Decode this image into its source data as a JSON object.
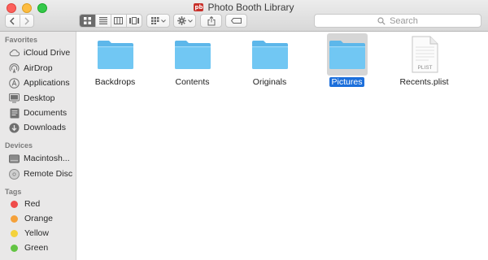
{
  "window": {
    "title": "Photo Booth Library",
    "title_icon_text": "pb"
  },
  "toolbar": {
    "back": "back",
    "forward": "forward",
    "view_modes": [
      "icon",
      "list",
      "column",
      "gallery"
    ],
    "active_view": "icon",
    "search_placeholder": "Search"
  },
  "sidebar": {
    "favorites_header": "Favorites",
    "favorites": [
      {
        "label": "iCloud Drive",
        "icon": "cloud-icon"
      },
      {
        "label": "AirDrop",
        "icon": "airdrop-icon"
      },
      {
        "label": "Applications",
        "icon": "applications-icon"
      },
      {
        "label": "Desktop",
        "icon": "desktop-icon"
      },
      {
        "label": "Documents",
        "icon": "documents-icon"
      },
      {
        "label": "Downloads",
        "icon": "downloads-icon"
      }
    ],
    "devices_header": "Devices",
    "devices": [
      {
        "label": "Macintosh...",
        "icon": "hard-drive-icon"
      },
      {
        "label": "Remote Disc",
        "icon": "disc-icon"
      }
    ],
    "tags_header": "Tags",
    "tags": [
      {
        "label": "Red",
        "color": "#ef4b4a"
      },
      {
        "label": "Orange",
        "color": "#f5a13a"
      },
      {
        "label": "Yellow",
        "color": "#f4d23b"
      },
      {
        "label": "Green",
        "color": "#63c443"
      }
    ]
  },
  "files": [
    {
      "name": "Backdrops",
      "kind": "folder",
      "selected": false
    },
    {
      "name": "Contents",
      "kind": "folder",
      "selected": false
    },
    {
      "name": "Originals",
      "kind": "folder",
      "selected": false
    },
    {
      "name": "Pictures",
      "kind": "folder",
      "selected": true
    },
    {
      "name": "Recents.plist",
      "kind": "plist",
      "badge": "PLIST",
      "selected": false
    }
  ],
  "colors": {
    "selection": "#1c6fdb",
    "folder": "#71c7f3"
  }
}
